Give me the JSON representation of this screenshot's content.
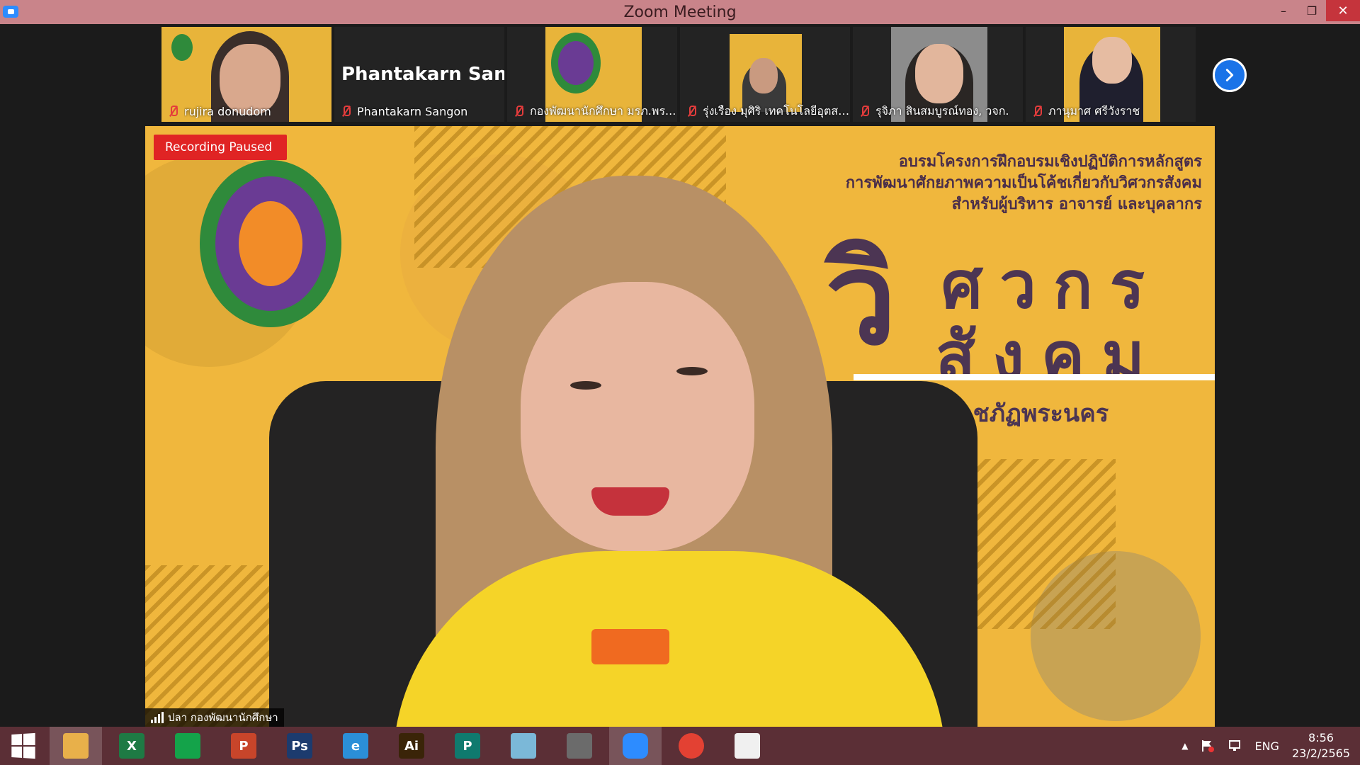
{
  "window": {
    "title": "Zoom Meeting"
  },
  "thumbnails": [
    {
      "name": "rujira donudom",
      "muted": true
    },
    {
      "name": "Phantakarn Sangon",
      "display_name": "Phantakarn  San...",
      "muted": true
    },
    {
      "name": "กองพัฒนานักศึกษา มรภ.พร...",
      "muted": true
    },
    {
      "name": "รุ่งเรือง มุศิริ เทคโนโลยีอุตสา...",
      "muted": true
    },
    {
      "name": "รุจิภา สินสมบูรณ์ทอง, วจก.",
      "muted": true
    },
    {
      "name": "ภานุมาศ ศรีวังราช",
      "muted": true
    }
  ],
  "main": {
    "recording_status": "Recording Paused",
    "speaker_name": "ปลา กองพัฒนานักศึกษา",
    "banner_lines": [
      "อบรมโครงการฝึกอบรมเชิงปฏิบัติการหลักสูตร",
      "การพัฒนาศักยภาพความเป็นโค้ชเกี่ยวกับวิศวกรสังคม",
      "สำหรับผู้บริหาร อาจารย์ และบุคลากร"
    ],
    "big_title_line1": "ศวกร",
    "big_title_line2": "สังคม",
    "big_title_prefix": "วิ",
    "university": "วิทยาลัยราชภัฏพระนคร"
  },
  "taskbar": {
    "apps": [
      {
        "name": "file-explorer",
        "label": "",
        "color": "#e8b04a"
      },
      {
        "name": "excel",
        "label": "X",
        "color": "#1e7a44"
      },
      {
        "name": "store",
        "label": "",
        "color": "#14a34a"
      },
      {
        "name": "powerpoint",
        "label": "P",
        "color": "#c8452a"
      },
      {
        "name": "photoshop",
        "label": "Ps",
        "color": "#1c3b6e"
      },
      {
        "name": "internet-explorer",
        "label": "e",
        "color": "#2b8fd8"
      },
      {
        "name": "illustrator",
        "label": "Ai",
        "color": "#3a2408"
      },
      {
        "name": "publisher",
        "label": "P",
        "color": "#0f7a6e"
      },
      {
        "name": "notepad",
        "label": "",
        "color": "#7bb8d8"
      },
      {
        "name": "photoscape",
        "label": "",
        "color": "#6b6b6b"
      },
      {
        "name": "zoom",
        "label": "",
        "color": "#2d8cff"
      },
      {
        "name": "chrome",
        "label": "",
        "color": "#e34133"
      },
      {
        "name": "office",
        "label": "",
        "color": "#f0f0f0"
      }
    ],
    "tray_lang": "ENG",
    "time": "8:56",
    "date": "23/2/2565"
  }
}
